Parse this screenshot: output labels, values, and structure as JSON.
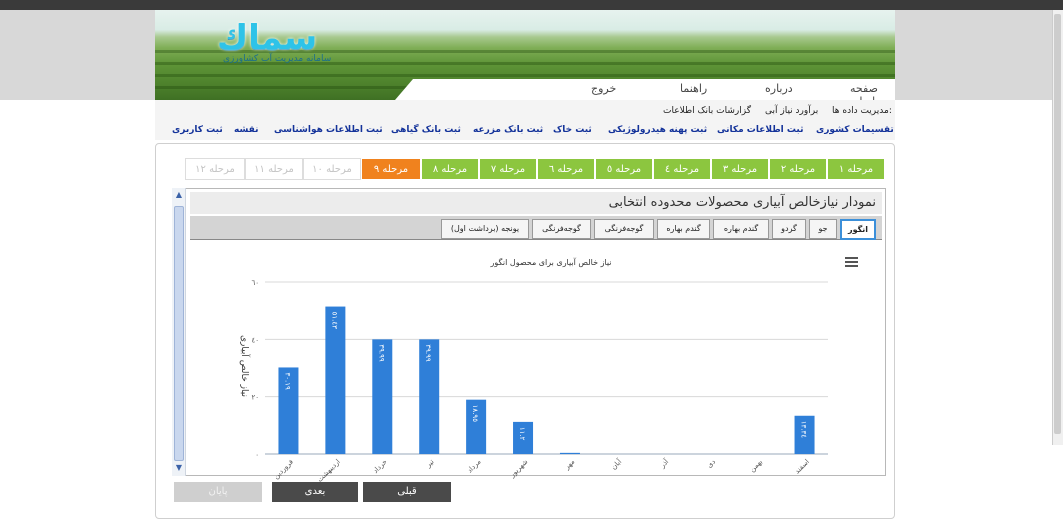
{
  "logo": {
    "title": "سماك",
    "subtitle": "سامانه مدیریت آب کشاورزی"
  },
  "nav": {
    "home": "صفحه اصلی",
    "about": "درباره",
    "help": "راهنما",
    "logout": "خروج"
  },
  "menu": {
    "row1": [
      "مدیریت داده ها:",
      "برآورد نیاز آبی",
      "گزارشات بانک اطلاعات"
    ],
    "row2": [
      "تقسیمات کشوری",
      "ثبت اطلاعات مکانی",
      "ثبت پهنه هیدرولوژیکی",
      "ثبت خاک",
      "ثبت بانک مزرعه",
      "ثبت بانک گیاهی",
      "ثبت اطلاعات هواشناسی",
      "نقشه",
      "ثبت کاربری"
    ]
  },
  "steps": [
    "مرحله ۱",
    "مرحله ۲",
    "مرحله ۳",
    "مرحله ٤",
    "مرحله ٥",
    "مرحله ٦",
    "مرحله ۷",
    "مرحله ۸",
    "مرحله ۹",
    "مرحله ۱۰",
    "مرحله ۱۱",
    "مرحله ۱۲"
  ],
  "active_step_index": 8,
  "panel_title": "نمودار نیازخالص آبیاری محصولات محدوده انتخابی",
  "tabs": [
    "انگور",
    "جو",
    "گردو",
    "گندم بهاره",
    "گندم بهاره",
    "گوجه‌فرنگی",
    "گوجه‌فرنگی",
    "یونجه (برداشت اول)"
  ],
  "active_tab_index": 0,
  "icons": {
    "menu": "hamburger-icon",
    "scroll_up": "chevron-up-icon",
    "scroll_down": "chevron-down-icon"
  },
  "colors": {
    "step_green": "#8cc63f",
    "step_active": "#f0821e",
    "bar": "#2f7fd8"
  },
  "buttons": {
    "prev": "قبلی",
    "next": "بعدی",
    "finish": "پایان"
  },
  "chart_data": {
    "type": "bar",
    "title": "نیاز خالص آبیاری برای محصول انگور",
    "ylabel": "نیاز خالص آبیاری",
    "xlabel": "",
    "ylim": [
      0,
      60
    ],
    "yticks": [
      "۰",
      "۲۰",
      "٤۰",
      "٦۰"
    ],
    "categories": [
      "فروردین",
      "اردیبهشت",
      "خرداد",
      "تیر",
      "مرداد",
      "شهریور",
      "مهر",
      "آبان",
      "آذر",
      "دی",
      "بهمن",
      "اسفند"
    ],
    "values": [
      30.19,
      51.43,
      39.99,
      39.99,
      18.95,
      11.2,
      0.4,
      0,
      0,
      0,
      0,
      13.34
    ],
    "labels": [
      "۳۰.۱۹",
      "٥۱.٤۳",
      "۳۹.۹۹",
      "۳۹.۹۹",
      "۱۸.۹٥",
      "۱۱.۲",
      "",
      "",
      "",
      "",
      "",
      "۱۳.۳٤"
    ]
  }
}
